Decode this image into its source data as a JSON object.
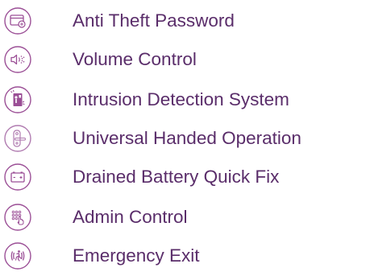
{
  "colors": {
    "icon": "#9b4f96",
    "text": "#5a2d6a",
    "background": "#ffffff"
  },
  "features": [
    {
      "label": "Anti Theft Password",
      "icon": "password-card-icon"
    },
    {
      "label": "Volume Control",
      "icon": "volume-icon"
    },
    {
      "label": "Intrusion Detection System",
      "icon": "intrusion-alarm-icon"
    },
    {
      "label": "Universal Handed Operation",
      "icon": "door-handle-icon"
    },
    {
      "label": "Drained Battery Quick Fix",
      "icon": "battery-icon"
    },
    {
      "label": "Admin Control",
      "icon": "admin-keypad-icon"
    },
    {
      "label": "Emergency Exit",
      "icon": "emergency-exit-icon"
    }
  ]
}
